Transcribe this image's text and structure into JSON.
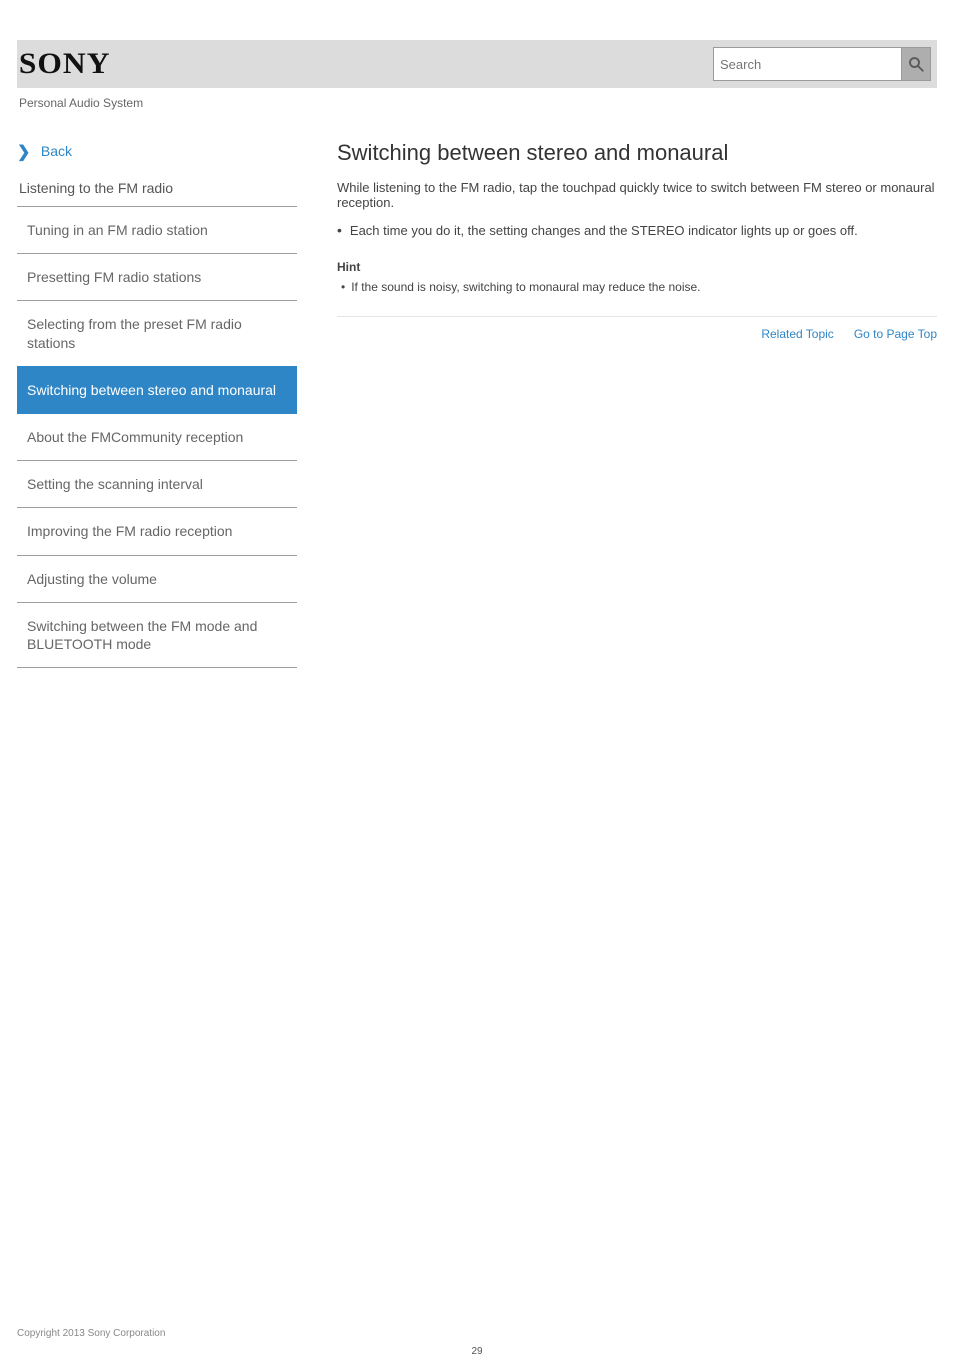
{
  "header": {
    "brand": "SONY",
    "product": "Personal Audio System",
    "search_placeholder": "Search"
  },
  "sidebar": {
    "back_label": "Back",
    "section": "Listening to the FM radio",
    "items": [
      "Tuning in an FM radio station",
      "Presetting FM radio stations",
      "Selecting from the preset FM radio stations",
      "Switching between stereo and monaural",
      "About the FMCommunity reception",
      "Setting the scanning interval",
      "Improving the FM radio reception",
      "Adjusting the volume",
      "Switching between the FM mode and BLUETOOTH mode"
    ],
    "active_index": 3
  },
  "content": {
    "title": "Switching between stereo and monaural",
    "intro": "While listening to the FM radio, tap the touchpad quickly twice to switch between FM stereo or monaural reception.",
    "bullets": [
      "Each time you do it, the setting changes and the STEREO indicator lights up or goes off."
    ],
    "hint_label": "Hint",
    "hint_body": "If the sound is noisy, switching to monaural may reduce the noise.",
    "links": {
      "top": "Go to Page Top",
      "related": "Related Topic"
    }
  },
  "footer": {
    "copyright": "Copyright 2013 Sony Corporation",
    "page_number": "29"
  }
}
